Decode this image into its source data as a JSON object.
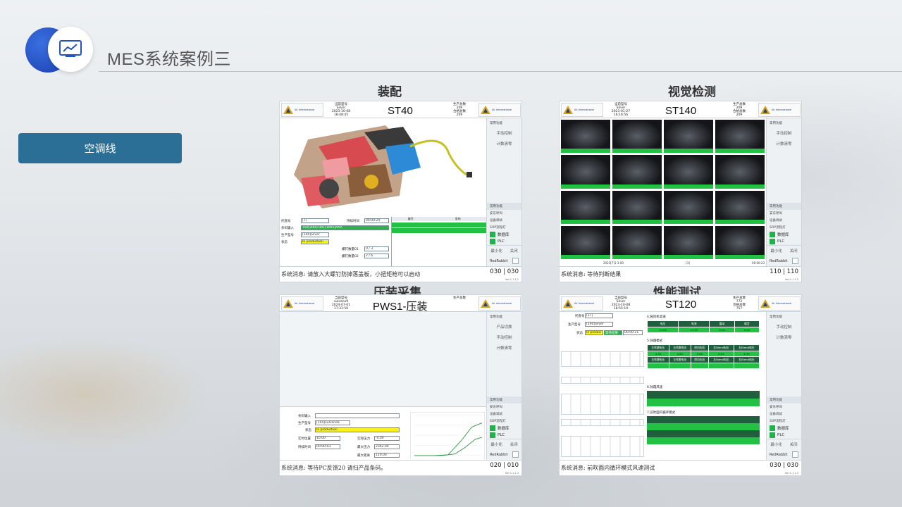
{
  "page": {
    "title": "MES系统案例三"
  },
  "side_button": "空调线",
  "sections": [
    "装配",
    "视觉检测",
    "压装采集",
    "性能测试"
  ],
  "common": {
    "logo_title": "Air International",
    "logo_sub": "空调热管理事业部",
    "model_label": "当前型号",
    "total_label": "生产总数",
    "ok_label": "合格总数",
    "side_common": "常用功能",
    "manual": "手动控制",
    "counter_clear": "计数清零",
    "product_switch": "产品切换",
    "fault_call": "安东呼叫",
    "device_debug": "设备调试",
    "sop": "SOP流程灯",
    "db": "数据库",
    "plc": "PLC",
    "minimize": "最小化",
    "close": "关闭",
    "redrabbit": "RedRabbit",
    "version": "Ver:1.1.1.2",
    "version2": "Ver:1.1.1.3"
  },
  "panels": [
    {
      "station": "ST40",
      "model": "Silver",
      "datetime": "2023-10-08\n18:48:45",
      "total": "209",
      "ok": "209",
      "message": "系统消息: 请放入大螺钉防掉落盖板，小扭矩枪可以启动",
      "page": "030 | 030",
      "fields": {
        "label": "托盘号",
        "tray": "[7]",
        "hold_label": "持续时间",
        "hold": "00:00:24",
        "barcode_label": "条码输入",
        "barcode": "T00[200]T3A1[1001]AAA",
        "product_label": "生产型号",
        "product": "[100]Silver",
        "state_label": "状态",
        "state": "In production",
        "screw1_label": "螺钉数量01",
        "screw1": "0 / 3",
        "screw2_label": "螺钉数量02",
        "screw2": "2 / 6",
        "col1": "编号",
        "col2": "条码"
      }
    },
    {
      "station": "ST140",
      "model": "Silver",
      "datetime": "2023-01-27\n16:16:56",
      "total": "209",
      "ok": "209",
      "message": "系统消息: 等待判断结果",
      "page": "110 | 110",
      "footer_left": "2023[7]1-3-00",
      "footer_mid": "[3]",
      "footer_right": "00:00:23"
    },
    {
      "station": "PWS1-压装",
      "model": "vulcano9",
      "datetime": "2024-07-01\n17:31:50",
      "total": "",
      "message": "系统消息: 等待PC反馈20  请扫产品条码。",
      "page": "020 | 010",
      "fields": {
        "barcode_label": "条码输入",
        "product_label": "生产型号",
        "product": "[104]vulcano9",
        "state_label": "状态",
        "state": "In production",
        "pos_label": "实时位置",
        "pos": "10.00",
        "pres_label": "实际压力",
        "pres": "-4.00",
        "hold_label": "持续时间",
        "hold": "00:00:03",
        "maxp_label": "最大压力",
        "maxp": "2362.00",
        "maxd_label": "最大距离",
        "maxd": "110.00"
      }
    },
    {
      "station": "ST120",
      "model": "Silver",
      "datetime": "2023-10-08\n18:55:10",
      "total": "772",
      "ok": "757",
      "message": "系统消息: 前吹面内循环模式风速测试",
      "page": "030 | 030",
      "fields": {
        "tray_label": "托盘号",
        "tray": "[17]",
        "product_label": "生产型号",
        "product": "[100]Silver",
        "state_label": "状态",
        "state": "In produc",
        "state2": "等待结果",
        "hold": "00:00:21",
        "t4": "4.鼓风机高速",
        "t4_cols": [
          "电压",
          "电流",
          "震动",
          "噪音"
        ],
        "t4_vals": [
          "12.00",
          "13.95",
          "0.00",
          "0.00"
        ],
        "t5": "5.除霜模式",
        "t5_cols": [
          "左吹脚电压",
          "左吹脚电压",
          "除风电压",
          "左Blend电压",
          "右Blend电压"
        ],
        "t5_vals": [
          "4.78",
          "4.81",
          "3.85",
          "0.01",
          "4.39"
        ],
        "t6": "6.除霜风速",
        "t7": "7.前吹面内循环模式"
      }
    }
  ],
  "chart_data": {
    "type": "line",
    "title": "",
    "series": [
      {
        "name": "",
        "values": [
          [
            0,
            0
          ],
          [
            60,
            0
          ],
          [
            100,
            2
          ],
          [
            140,
            38
          ],
          [
            170,
            70
          ],
          [
            200,
            80
          ]
        ]
      },
      {
        "name": "",
        "values": [
          [
            0,
            0
          ],
          [
            80,
            0
          ],
          [
            120,
            4
          ],
          [
            150,
            20
          ],
          [
            180,
            40
          ],
          [
            200,
            45
          ]
        ]
      }
    ],
    "xlim": [
      0,
      200
    ],
    "ylim": [
      0,
      100
    ]
  }
}
